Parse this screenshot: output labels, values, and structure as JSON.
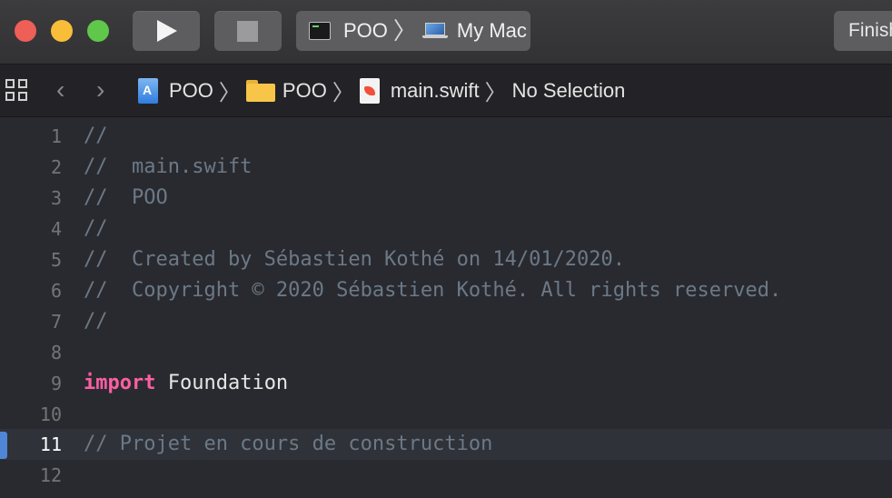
{
  "toolbar": {
    "run_icon": "play-icon",
    "stop_icon": "stop-icon",
    "scheme": {
      "project": "POO",
      "destination": "My Mac"
    },
    "activity_text": "Finished running POO"
  },
  "jumpbar": {
    "crumbs": [
      "POO",
      "POO",
      "main.swift",
      "No Selection"
    ],
    "icons": [
      "project-icon",
      "folder-icon",
      "swift-file-icon"
    ]
  },
  "editor": {
    "current_line": 11,
    "lines": [
      {
        "n": "1",
        "text": "//"
      },
      {
        "n": "2",
        "text": "//  main.swift"
      },
      {
        "n": "3",
        "text": "//  POO"
      },
      {
        "n": "4",
        "text": "//"
      },
      {
        "n": "5",
        "text": "//  Created by Sébastien Kothé on 14/01/2020."
      },
      {
        "n": "6",
        "text": "//  Copyright © 2020 Sébastien Kothé. All rights reserved."
      },
      {
        "n": "7",
        "text": "//"
      },
      {
        "n": "8",
        "text": ""
      },
      {
        "n": "9",
        "keyword": "import",
        "text": " Foundation"
      },
      {
        "n": "10",
        "text": ""
      },
      {
        "n": "11",
        "text": "// Projet en cours de construction"
      },
      {
        "n": "12",
        "text": ""
      }
    ]
  },
  "colors": {
    "background": "#292a30",
    "comment": "#6c7986",
    "keyword": "#fc5fa3",
    "current_line": "#2f3239",
    "line_marker": "#4f86d6"
  }
}
